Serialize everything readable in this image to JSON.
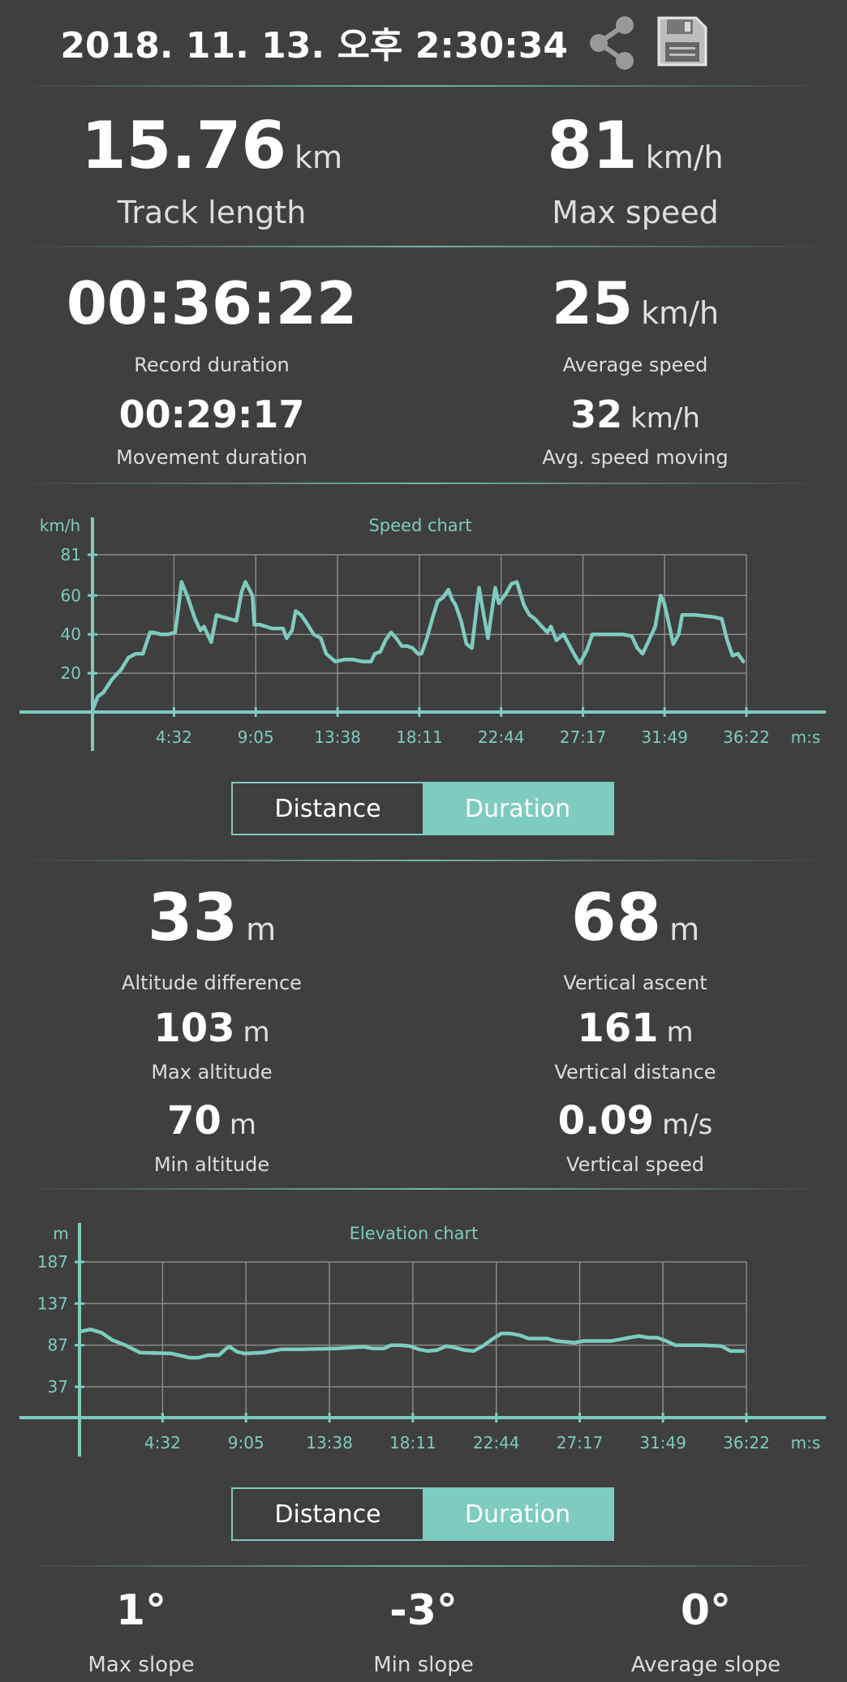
{
  "header": {
    "datetime": "2018. 11. 13. 오후 2:30:34",
    "share_icon": "share-icon",
    "save_icon": "floppy-disk-icon"
  },
  "summary": {
    "track_length": {
      "value": "15.76",
      "unit": "km",
      "label": "Track length"
    },
    "max_speed": {
      "value": "81",
      "unit": "km/h",
      "label": "Max speed"
    }
  },
  "durations": {
    "record_duration": {
      "value": "00:36:22",
      "label": "Record duration"
    },
    "average_speed": {
      "value": "25",
      "unit": "km/h",
      "label": "Average speed"
    },
    "movement_duration": {
      "value": "00:29:17",
      "label": "Movement duration"
    },
    "avg_speed_moving": {
      "value": "32",
      "unit": "km/h",
      "label": "Avg. speed moving"
    }
  },
  "speed_chart_toggle": {
    "distance": "Distance",
    "duration": "Duration",
    "selected": "Duration"
  },
  "altitude": {
    "altitude_difference": {
      "value": "33",
      "unit": "m",
      "label": "Altitude difference"
    },
    "vertical_ascent": {
      "value": "68",
      "unit": "m",
      "label": "Vertical ascent"
    },
    "max_altitude": {
      "value": "103",
      "unit": "m",
      "label": "Max altitude"
    },
    "vertical_distance": {
      "value": "161",
      "unit": "m",
      "label": "Vertical distance"
    },
    "min_altitude": {
      "value": "70",
      "unit": "m",
      "label": "Min altitude"
    },
    "vertical_speed": {
      "value": "0.09",
      "unit": "m/s",
      "label": "Vertical speed"
    }
  },
  "elevation_chart_toggle": {
    "distance": "Distance",
    "duration": "Duration",
    "selected": "Duration"
  },
  "slope": {
    "max_slope": {
      "value": "1°",
      "label": "Max slope"
    },
    "min_slope": {
      "value": "-3°",
      "label": "Min slope"
    },
    "average_slope": {
      "value": "0°",
      "label": "Average slope"
    }
  },
  "colors": {
    "accent": "#7ecbbf",
    "background": "#3f3f3f",
    "text": "#ffffff",
    "grid": "#8a8a8a"
  },
  "chart_data": [
    {
      "type": "line",
      "title": "Speed chart",
      "ylabel": "km/h",
      "xlabel": "m:s",
      "ylim": [
        0,
        81
      ],
      "yticks": [
        20,
        40,
        60,
        81
      ],
      "xlim": [
        0,
        36.37
      ],
      "xticks": [
        4.53,
        9.08,
        13.63,
        18.18,
        22.73,
        27.28,
        31.82,
        36.37
      ],
      "xtick_labels": [
        "4:32",
        "9:05",
        "13:38",
        "18:11",
        "22:44",
        "27:17",
        "31:49",
        "36:22"
      ],
      "grid": true,
      "series": [
        {
          "x": [
            0,
            0.3,
            0.6,
            1.1,
            1.6,
            2.0,
            2.4,
            2.8,
            3.2,
            3.4,
            3.8,
            4.2,
            4.6,
            4.8,
            4.95,
            5.3,
            5.7,
            6.0,
            6.2,
            6.6,
            6.9,
            7.2,
            7.6,
            8.0,
            8.3,
            8.5,
            8.9,
            9.0,
            9.3,
            10.0,
            10.6,
            10.8,
            11.1,
            11.3,
            11.6,
            11.9,
            12.3,
            12.7,
            13.0,
            13.5,
            14.0,
            14.5,
            15.0,
            15.5,
            15.7,
            16.0,
            16.3,
            16.6,
            16.9,
            17.2,
            17.5,
            17.8,
            18.1,
            18.3,
            18.6,
            18.9,
            19.2,
            19.5,
            19.8,
            20.0,
            20.2,
            20.5,
            20.8,
            21.1,
            21.5,
            21.8,
            22.0,
            22.4,
            22.6,
            23.0,
            23.3,
            23.6,
            24.0,
            24.3,
            24.6,
            25.0,
            25.3,
            25.5,
            25.8,
            26.2,
            26.6,
            26.9,
            27.1,
            27.5,
            27.8,
            28.5,
            29.5,
            30.0,
            30.3,
            30.6,
            30.9,
            31.3,
            31.6,
            31.8,
            32.0,
            32.3,
            32.6,
            32.8,
            33.0,
            33.5,
            34.5,
            35.0,
            35.3,
            35.6,
            35.9,
            36.2
          ],
          "values": [
            1,
            8,
            10,
            17,
            22,
            28,
            30,
            30,
            41,
            41,
            40,
            40,
            41,
            55,
            67,
            59,
            48,
            42,
            44,
            36,
            50,
            49,
            48,
            47,
            62,
            67,
            60,
            45,
            45,
            43,
            43,
            38,
            42,
            52,
            50,
            46,
            40,
            38,
            30,
            26,
            27,
            27,
            26,
            26,
            30,
            31,
            37,
            41,
            38,
            34,
            34,
            33,
            30,
            30,
            38,
            48,
            57,
            59,
            63,
            58,
            55,
            47,
            35,
            33,
            64,
            48,
            38,
            64,
            56,
            61,
            66,
            67,
            55,
            50,
            48,
            44,
            41,
            44,
            37,
            40,
            33,
            28,
            25,
            32,
            40,
            40,
            40,
            39,
            33,
            30,
            36,
            44,
            60,
            56,
            48,
            35,
            40,
            50,
            50,
            50,
            49,
            48,
            37,
            29,
            30,
            26
          ]
        }
      ]
    },
    {
      "type": "line",
      "title": "Elevation chart",
      "ylabel": "m",
      "xlabel": "m:s",
      "ylim": [
        0,
        187
      ],
      "yticks": [
        37,
        87,
        137,
        187
      ],
      "xlim": [
        0,
        36.37
      ],
      "xticks": [
        4.53,
        9.08,
        13.63,
        18.18,
        22.73,
        27.28,
        31.82,
        36.37
      ],
      "xtick_labels": [
        "4:32",
        "9:05",
        "13:38",
        "18:11",
        "22:44",
        "27:17",
        "31:49",
        "36:22"
      ],
      "grid": true,
      "series": [
        {
          "x": [
            0,
            0.6,
            1.2,
            1.8,
            2.5,
            3.3,
            5.0,
            6.0,
            6.5,
            7.0,
            7.6,
            8.0,
            8.2,
            8.6,
            9.0,
            10.0,
            11.0,
            12.0,
            14.0,
            15.5,
            16.0,
            16.6,
            17.0,
            17.5,
            18.0,
            18.5,
            19.0,
            19.5,
            20.0,
            20.5,
            21.0,
            21.5,
            22.0,
            22.5,
            23.0,
            23.5,
            24.0,
            24.5,
            25.0,
            25.5,
            26.0,
            27.0,
            27.5,
            28.0,
            29.0,
            30.0,
            30.5,
            31.0,
            31.5,
            32.0,
            32.5,
            33.0,
            34.0,
            35.0,
            35.5,
            36.2
          ],
          "values": [
            103,
            106,
            102,
            93,
            87,
            78,
            77,
            72,
            72,
            75,
            75,
            83,
            85,
            79,
            77,
            78,
            82,
            82,
            83,
            85,
            83,
            83,
            87,
            87,
            86,
            82,
            80,
            81,
            86,
            84,
            81,
            80,
            86,
            94,
            101,
            101,
            99,
            95,
            95,
            95,
            92,
            90,
            92,
            92,
            92,
            96,
            98,
            96,
            96,
            92,
            87,
            87,
            87,
            86,
            80,
            80
          ]
        }
      ]
    }
  ]
}
